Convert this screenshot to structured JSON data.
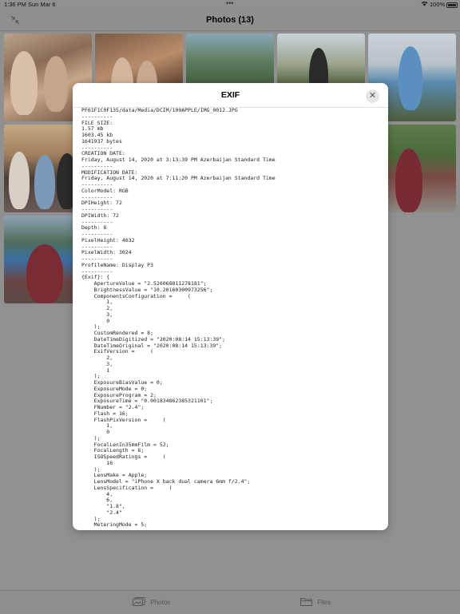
{
  "status_bar": {
    "time": "1:36 PM",
    "date": "Sun Mar 6",
    "battery": "100%"
  },
  "navbar": {
    "title": "Photos (13)"
  },
  "photos": [
    {
      "name": "photo-1"
    },
    {
      "name": "photo-2"
    },
    {
      "name": "photo-3"
    },
    {
      "name": "photo-4"
    },
    {
      "name": "photo-5"
    },
    {
      "name": "photo-6"
    },
    {
      "name": "photo-10"
    },
    {
      "name": "photo-11"
    }
  ],
  "modal": {
    "title": "EXIF",
    "content": "PF61F1C0F135/data/Media/DCIM/100APPLE/IMG_0012.JPG\n----------\nFILE SIZE:\n1.57 mb\n1603.45 kb\n1641937 bytes\n----------\nCREATION DATE:\nFriday, August 14, 2020 at 3:13:39 PM Azerbaijan Standard Time\n----------\nMODIFICATION DATE:\nFriday, August 14, 2020 at 7:11:20 PM Azerbaijan Standard Time\n----------\nColorModel: RGB\n----------\nDPIHeight: 72\n----------\nDPIWidth: 72\n----------\nDepth: 8\n----------\nPixelHeight: 4032\n----------\nPixelWidth: 3024\n----------\nProfileName: Display P3\n----------\n{Exif}: {\n    ApertureValue = \"2.526068811278181\";\n    BrightnessValue = \"10.20160300973256\";\n    ComponentsConfiguration =     (\n        1,\n        2,\n        3,\n        0\n    );\n    CustomRendered = 8;\n    DateTimeDigitized = \"2020:08:14 15:13:39\";\n    DateTimeOriginal = \"2020:08:14 15:13:39\";\n    ExifVersion =     (\n        2,\n        3,\n        1\n    );\n    ExposureBiasValue = 0;\n    ExposureMode = 0;\n    ExposureProgram = 2;\n    ExposureTime = \"0.001834862385321101\";\n    FNumber = \"2.4\";\n    Flash = 16;\n    FlashPixVersion =     (\n        1,\n        0\n    );\n    FocalLenIn35mmFilm = 52;\n    FocalLength = 6;\n    ISOSpeedRatings =     (\n        16\n    );\n    LensMake = Apple;\n    LensModel = \"iPhone X back dual camera 6mm f/2.4\";\n    LensSpecification =     (\n        4,\n        6,\n        \"1.8\",\n        \"2.4\"\n    );\n    MeteringMode = 5;\n    OffsetTime = \"+04:00\";"
  },
  "tabbar": {
    "photos_label": "Photos",
    "files_label": "Files"
  }
}
